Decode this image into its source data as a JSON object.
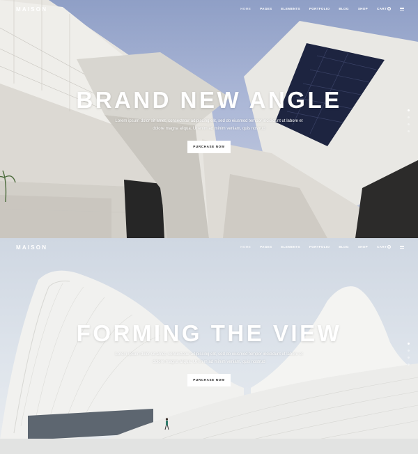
{
  "nav": {
    "logo": "MAISON",
    "items": [
      {
        "label": "HOME",
        "active": true
      },
      {
        "label": "PAGES"
      },
      {
        "label": "ELEMENTS"
      },
      {
        "label": "PORTFOLIO"
      },
      {
        "label": "BLOG"
      },
      {
        "label": "SHOP"
      }
    ],
    "cart_label": "CART",
    "cart_count": "0"
  },
  "slides": [
    {
      "title": "BRAND NEW ANGLE",
      "text_line1": "Lorem ipsum dolor sit amet, consectetur adipiscing elit, sed do eiusmod tempor incididunt ut labore et",
      "text_line2": "dolore magna aliqua. Ut enim ad minim veniam, quis nostrud",
      "button": "PURCHASE NOW"
    },
    {
      "title": "FORMING THE VIEW",
      "text_line1": "Lorem ipsum dolor sit amet, consectetur adipiscing elit, sed do eiusmod tempor incididunt ut labore et",
      "text_line2": "dolore magna aliqua. Ut enim ad minim veniam, quis nostrud",
      "button": "PURCHASE NOW"
    }
  ],
  "slider": {
    "total": 4,
    "active_index": 0
  },
  "colors": {
    "sky_top": "#8f9fc6",
    "facade": "#e6e4df",
    "glass": "#1d2440",
    "dark": "#2a2a2a"
  }
}
